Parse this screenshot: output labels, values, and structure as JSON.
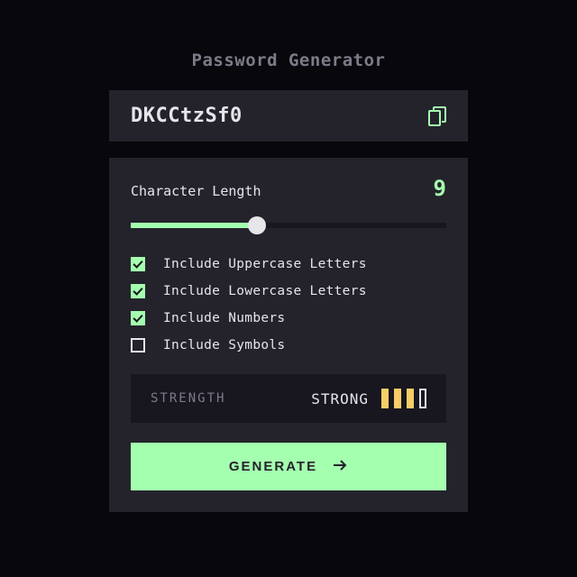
{
  "title": "Password Generator",
  "password": "DKCCtzSf0",
  "length": {
    "label": "Character Length",
    "value": "9",
    "slider_percent": 40
  },
  "options": {
    "uppercase": {
      "label": "Include Uppercase Letters",
      "checked": true
    },
    "lowercase": {
      "label": "Include Lowercase Letters",
      "checked": true
    },
    "numbers": {
      "label": "Include Numbers",
      "checked": true
    },
    "symbols": {
      "label": "Include Symbols",
      "checked": false
    }
  },
  "strength": {
    "label": "STRENGTH",
    "value": "STRONG",
    "bars_filled": 3,
    "bars_total": 4,
    "fill_color": "#f8cd65"
  },
  "generate_label": "GENERATE",
  "colors": {
    "accent": "#a4ffaf",
    "panel": "#24232b",
    "panel_dark": "#18171f",
    "bg": "#08070b"
  }
}
